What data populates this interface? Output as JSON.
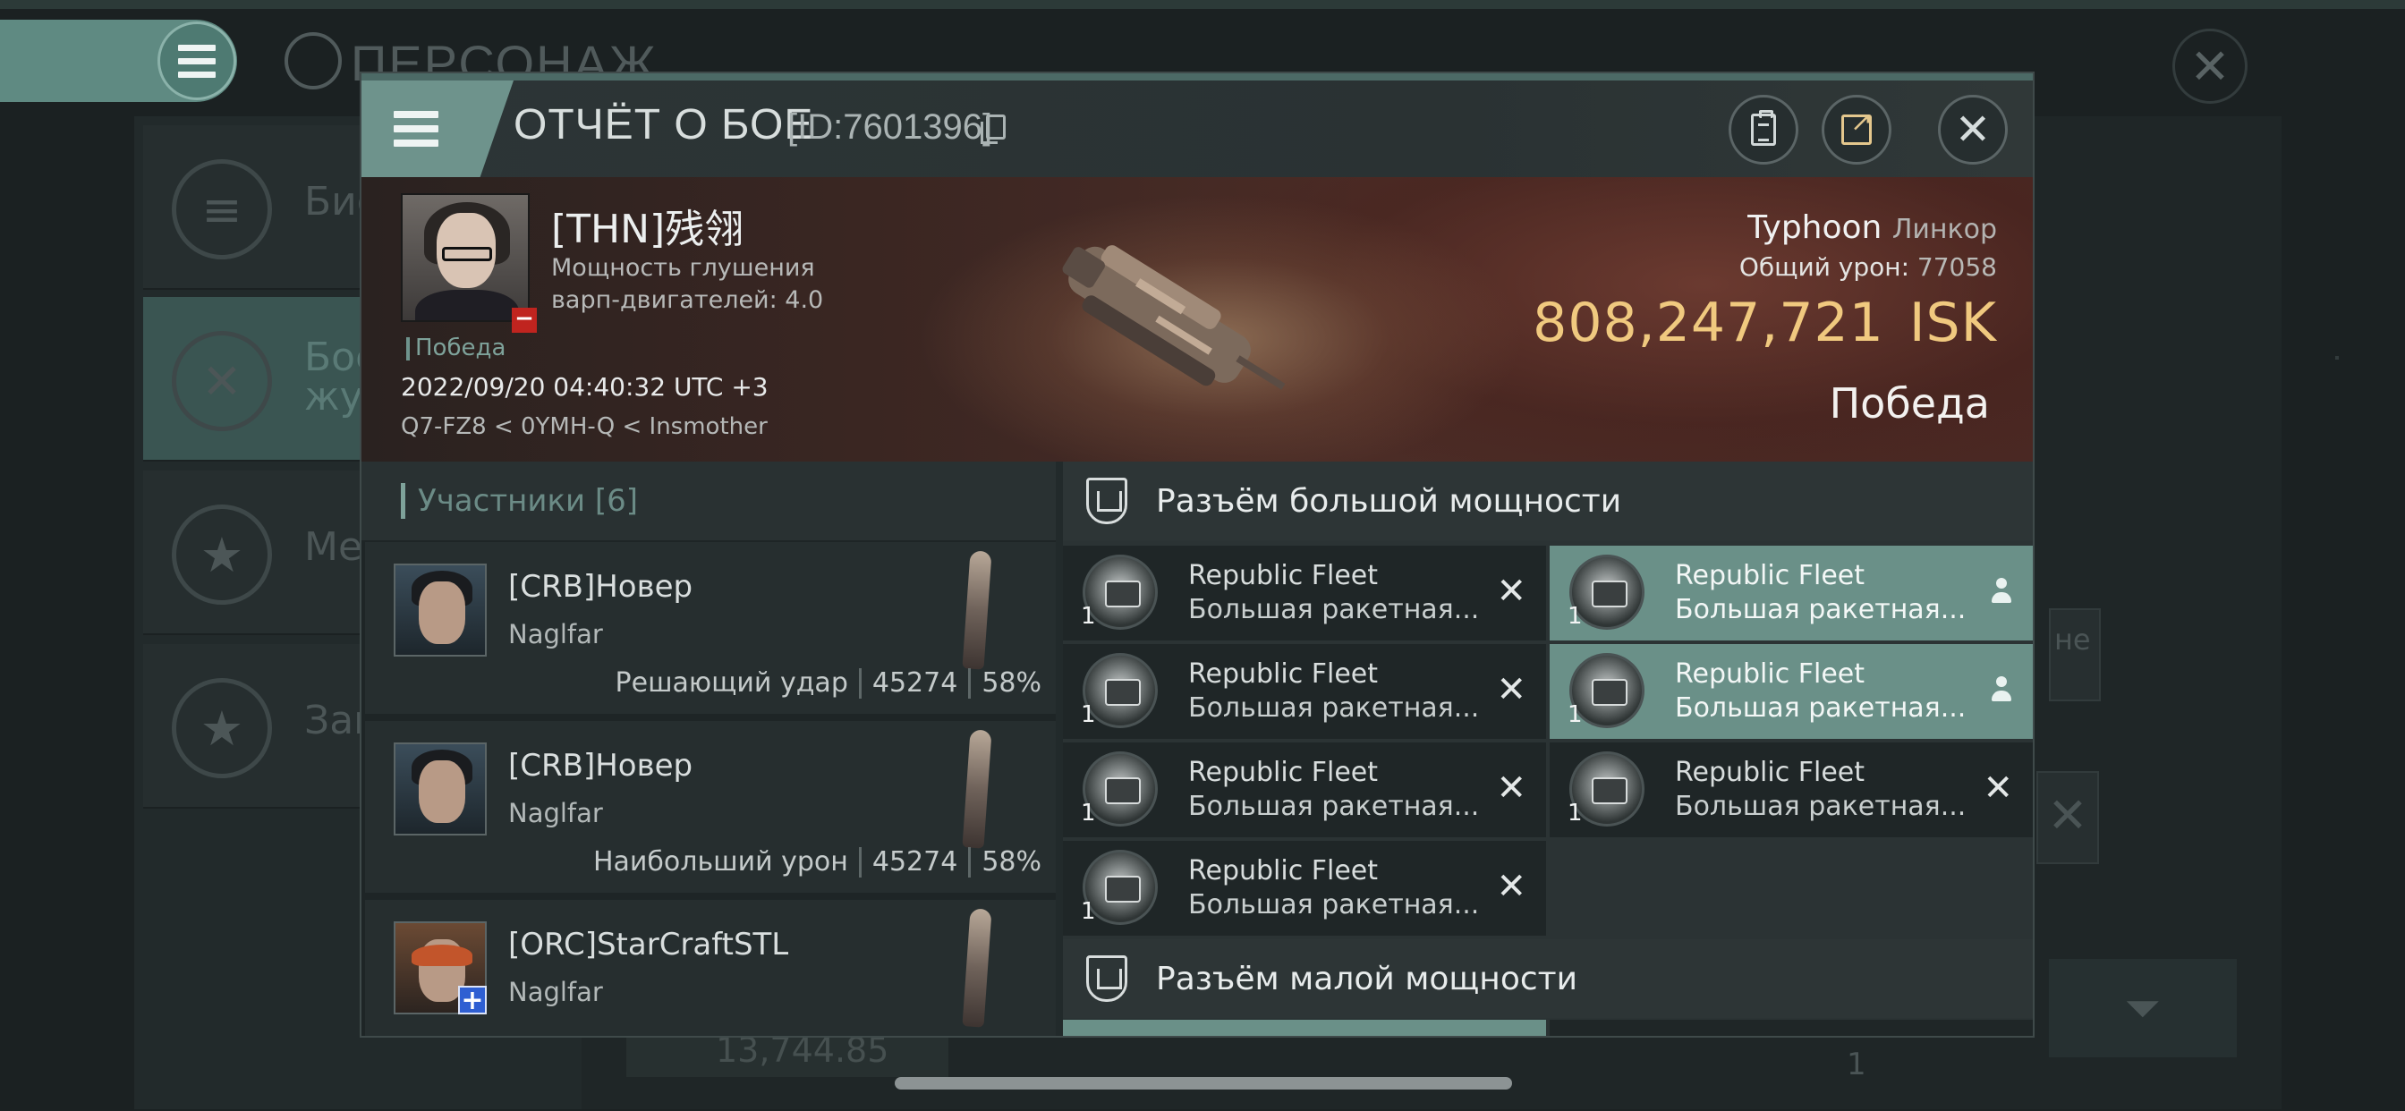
{
  "background": {
    "character_title": "ПЕРСОНАЖ",
    "side_items": [
      {
        "label": "Био",
        "icon": "list-icon"
      },
      {
        "label": "Бое\nжур",
        "icon": "crossed-swords-icon"
      },
      {
        "label": "Мед",
        "icon": "star-shield-icon"
      },
      {
        "label": "Зан",
        "icon": "star-circle-icon"
      }
    ],
    "isk_partial": "13,744.85",
    "partial_right_text": "не",
    "partial_qty": "1"
  },
  "modal": {
    "title": "ОТЧЁТ О БОЕ",
    "id_label": "[ID:7601396]",
    "victim": {
      "name": "[THN]残翎",
      "stat_line1": "Мощность глушения",
      "stat_line2": "варп-двигателей: 4.0",
      "status_tag": "Победа",
      "datetime": "2022/09/20 04:40:32 UTC +3",
      "location": "Q7-FZ8 < 0YMH-Q < Insmother"
    },
    "ship": {
      "name": "Typhoon",
      "class": "Линкор",
      "damage_label": "Общий урон:",
      "damage_value": "77058",
      "isk_value": "808,247,721",
      "isk_unit": "ISK",
      "result": "Победа"
    },
    "participants": {
      "header": "Участники [6]",
      "rows": [
        {
          "name": "[CRB]Новер",
          "ship": "Naglfar",
          "role": "Решающий удар",
          "damage": "45274",
          "percent": "58%"
        },
        {
          "name": "[CRB]Новер",
          "ship": "Naglfar",
          "role": "Наибольший урон",
          "damage": "45274",
          "percent": "58%"
        },
        {
          "name": "[ORC]StarCraftSTL",
          "ship": "Naglfar",
          "role": "",
          "damage": "",
          "percent": ""
        }
      ]
    },
    "fitting": {
      "high_slot_title": "Разъём большой мощности",
      "low_slot_title": "Разъём малой мощности",
      "modules": [
        {
          "name": "Republic Fleet",
          "type": "Большая ракетная...",
          "qty": "1",
          "state": "destroyed"
        },
        {
          "name": "Republic Fleet",
          "type": "Большая ракетная...",
          "qty": "1",
          "state": "dropped"
        },
        {
          "name": "Republic Fleet",
          "type": "Большая ракетная...",
          "qty": "1",
          "state": "destroyed"
        },
        {
          "name": "Republic Fleet",
          "type": "Большая ракетная...",
          "qty": "1",
          "state": "dropped"
        },
        {
          "name": "Republic Fleet",
          "type": "Большая ракетная...",
          "qty": "1",
          "state": "destroyed"
        },
        {
          "name": "Republic Fleet",
          "type": "Большая ракетная...",
          "qty": "1",
          "state": "destroyed"
        },
        {
          "name": "Republic Fleet",
          "type": "Большая ракетная...",
          "qty": "1",
          "state": "destroyed"
        }
      ]
    }
  },
  "colors": {
    "accent_teal": "#6e938c",
    "isk_gold": "#f0c97f",
    "loss_red": "#c0241f",
    "ally_blue": "#2f5fd2"
  }
}
